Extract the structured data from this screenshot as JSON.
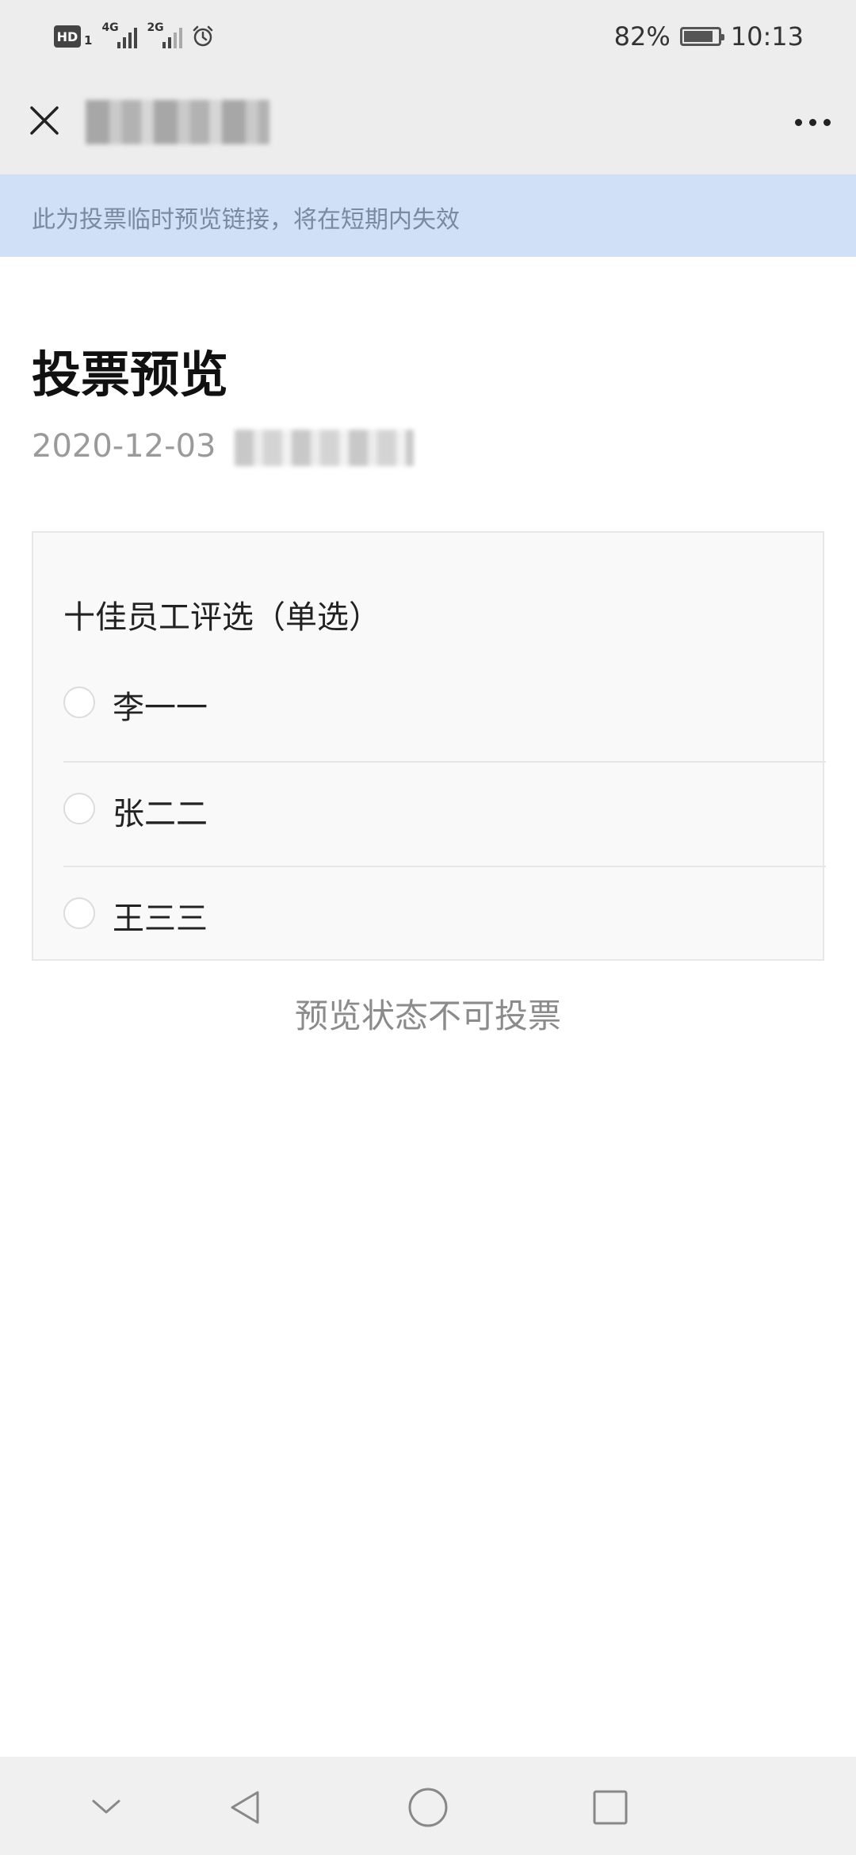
{
  "status_bar": {
    "hd_label": "HD",
    "sim_label": "1",
    "network1": "4G",
    "network2": "2G",
    "battery": "82%",
    "time": "10:13"
  },
  "nav_bar": {
    "close_icon": "close-icon",
    "more_icon": "more-icon"
  },
  "notice": {
    "text": "此为投票临时预览链接，将在短期内失效"
  },
  "page": {
    "title": "投票预览",
    "date": "2020-12-03"
  },
  "vote": {
    "question": "十佳员工评选（单选）",
    "options": [
      {
        "label": "李一一"
      },
      {
        "label": "张二二"
      },
      {
        "label": "王三三"
      }
    ],
    "note": "预览状态不可投票"
  },
  "system_nav": {
    "icons": [
      "chevron-down-icon",
      "back-icon",
      "home-icon",
      "recents-icon"
    ]
  }
}
